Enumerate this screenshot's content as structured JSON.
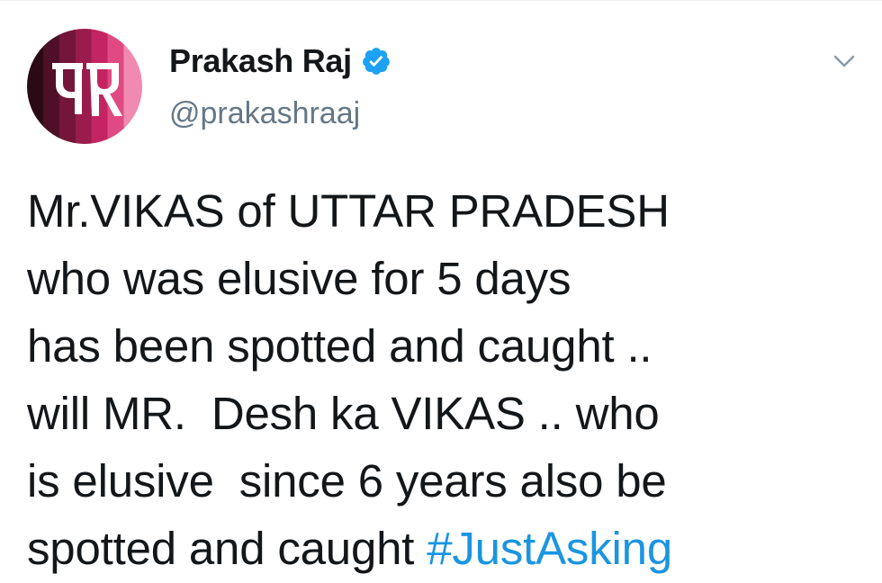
{
  "user": {
    "avatar_icon": "prakash-raj-logo-icon",
    "display_name": "Prakash Raj",
    "verified_icon": "verified-badge-icon",
    "handle": "@prakashraaj"
  },
  "header": {
    "menu_icon": "chevron-down-icon"
  },
  "tweet": {
    "lines": [
      "Mr.VIKAS of UTTAR PRADESH",
      "who was elusive for 5 days",
      "has been spotted and caught ..",
      "will MR.  Desh ka VIKAS .. who",
      "is elusive  since 6 years also be",
      "spotted and caught "
    ],
    "hashtag": "#JustAsking"
  },
  "colors": {
    "text": "#14171a",
    "handle": "#657786",
    "link": "#1b95e0",
    "verified": "#1da1f2",
    "chevron": "#8899a6"
  }
}
